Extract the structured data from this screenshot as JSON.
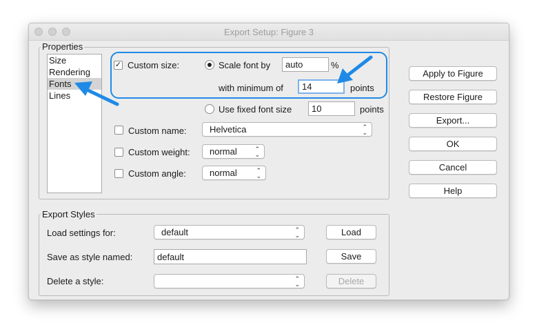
{
  "window": {
    "title": "Export Setup: Figure 3"
  },
  "properties": {
    "group_label": "Properties",
    "list_items": [
      "Size",
      "Rendering",
      "Fonts",
      "Lines"
    ],
    "selected_item": "Fonts"
  },
  "fonts": {
    "custom_size": {
      "label": "Custom size:",
      "checked": true
    },
    "scale_font": {
      "label": "Scale font by",
      "value": "auto",
      "unit": "%",
      "selected": true
    },
    "minimum": {
      "label": "with minimum of",
      "value": "14",
      "unit": "points"
    },
    "fixed_font": {
      "label": "Use fixed font size",
      "value": "10",
      "unit": "points",
      "selected": false
    },
    "custom_name": {
      "label": "Custom name:",
      "checked": false,
      "value": "Helvetica"
    },
    "custom_weight": {
      "label": "Custom weight:",
      "checked": false,
      "value": "normal"
    },
    "custom_angle": {
      "label": "Custom angle:",
      "checked": false,
      "value": "normal"
    }
  },
  "actions": {
    "apply": "Apply to Figure",
    "restore": "Restore Figure",
    "export": "Export...",
    "ok": "OK",
    "cancel": "Cancel",
    "help": "Help"
  },
  "export_styles": {
    "group_label": "Export Styles",
    "load_label": "Load settings for:",
    "load_value": "default",
    "load_button": "Load",
    "save_label": "Save as style named:",
    "save_value": "default",
    "save_button": "Save",
    "delete_label": "Delete a style:",
    "delete_value": "",
    "delete_button": "Delete"
  },
  "colors": {
    "annotation_blue": "#1f8ae6"
  }
}
